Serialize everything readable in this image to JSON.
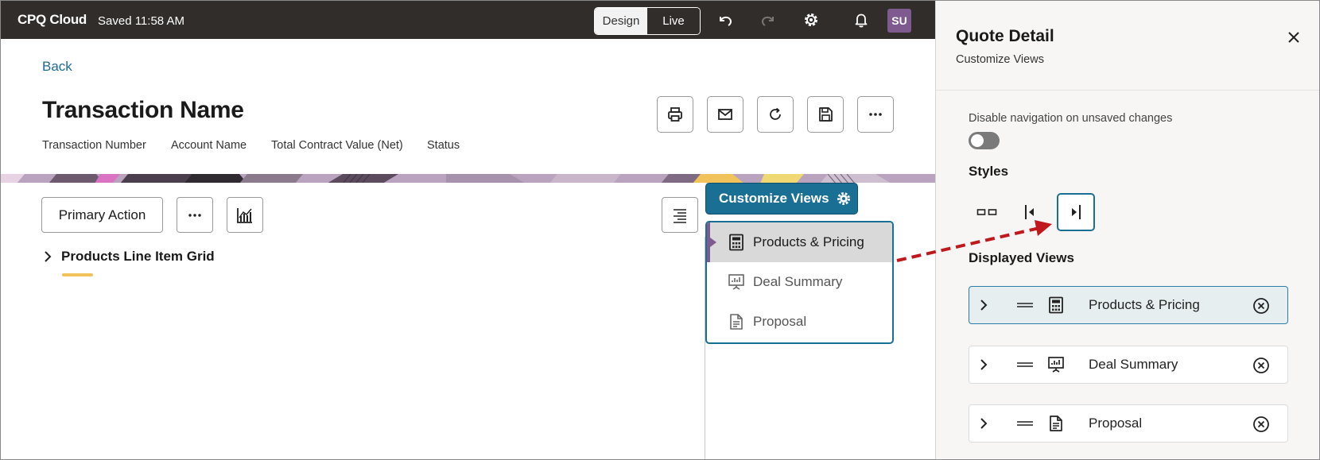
{
  "topbar": {
    "app_title": "CPQ Cloud",
    "saved_status": "Saved 11:58 AM",
    "mode_design": "Design",
    "mode_live": "Live",
    "mode_selected": "Design",
    "icons": [
      "undo-icon",
      "redo-icon",
      "gear-icon",
      "bell-icon"
    ],
    "avatar_initials": "SU",
    "avatar_color": "#7e5a8f"
  },
  "header": {
    "back_label": "Back",
    "title": "Transaction Name",
    "meta": [
      "Transaction Number",
      "Account Name",
      "Total Contract Value (Net)",
      "Status"
    ],
    "action_icons": [
      "print-icon",
      "email-icon",
      "refresh-icon",
      "save-icon",
      "more-icon"
    ]
  },
  "toolbar": {
    "primary_action": "Primary Action",
    "more_icon": "more-icon",
    "chart_icon": "chart-icon",
    "align_icon": "align-right-icon"
  },
  "grid": {
    "title": "Products Line Item Grid"
  },
  "customize_views": {
    "button_label": "Customize Views",
    "accent_color": "#1a6f94",
    "views": [
      {
        "label": "Products & Pricing",
        "icon": "calculator-icon",
        "active": true
      },
      {
        "label": "Deal Summary",
        "icon": "presentation-icon",
        "active": false
      },
      {
        "label": "Proposal",
        "icon": "document-icon",
        "active": false
      }
    ]
  },
  "side_panel": {
    "title": "Quote Detail",
    "subtitle": "Customize Views",
    "nav_toggle_label": "Disable navigation on unsaved changes",
    "nav_toggle_on": false,
    "styles_label": "Styles",
    "styles": [
      {
        "icon": "tabs-horizontal-icon",
        "selected": false
      },
      {
        "icon": "panel-left-icon",
        "selected": false
      },
      {
        "icon": "panel-right-icon",
        "selected": true
      }
    ],
    "displayed_label": "Displayed Views",
    "displayed_views": [
      {
        "label": "Products & Pricing",
        "icon": "calculator-icon",
        "active": true
      },
      {
        "label": "Deal Summary",
        "icon": "presentation-icon",
        "active": false
      },
      {
        "label": "Proposal",
        "icon": "document-icon",
        "active": false
      }
    ]
  },
  "annotation": {
    "arrow_color": "#c0191d"
  }
}
